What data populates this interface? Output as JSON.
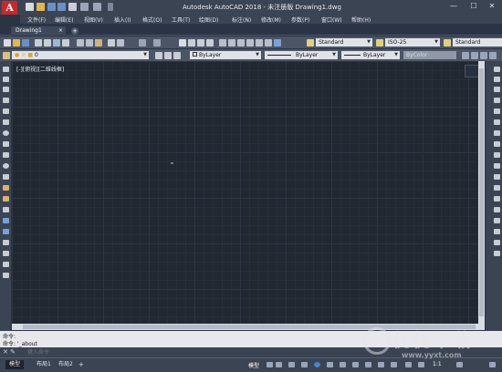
{
  "titlebar": {
    "app_logo": "A",
    "title": "Autodesk AutoCAD 2018 - 未注册版     Drawing1.dwg",
    "minimize": "—",
    "maximize": "☐",
    "close": "✕"
  },
  "menu": [
    "文件(F)",
    "编辑(E)",
    "视图(V)",
    "插入(I)",
    "格式(O)",
    "工具(T)",
    "绘图(D)",
    "标注(N)",
    "修改(M)",
    "参数(P)",
    "窗口(W)",
    "帮助(H)"
  ],
  "tabs": {
    "active": "Drawing1",
    "close": "×",
    "add": "+"
  },
  "toolbar1": {
    "text_style": "Standard",
    "dim_style": "ISO-25",
    "table_style": "Standard"
  },
  "toolbar2": {
    "layer": "0",
    "color": "ByLayer",
    "linetype": "ByLayer",
    "lineweight": "ByLayer",
    "plot_style": "ByColor"
  },
  "drawing": {
    "viewport_label": "[-][俯视][二维线框]"
  },
  "command": {
    "history": [
      "命令:",
      "命令: '_about"
    ],
    "placeholder": "键入命令",
    "icons": "✕ ✎"
  },
  "status": {
    "layout_tabs": [
      "模型",
      "布局1",
      "布局2"
    ],
    "add": "+",
    "model": "模型",
    "scale": "1:1"
  },
  "watermark": {
    "text": "优优下载",
    "url": "www.yyxt.com"
  },
  "colors": {
    "logo_red": "#c8282b",
    "canvas_bg": "#212832",
    "chrome_bg": "#3b4453"
  }
}
